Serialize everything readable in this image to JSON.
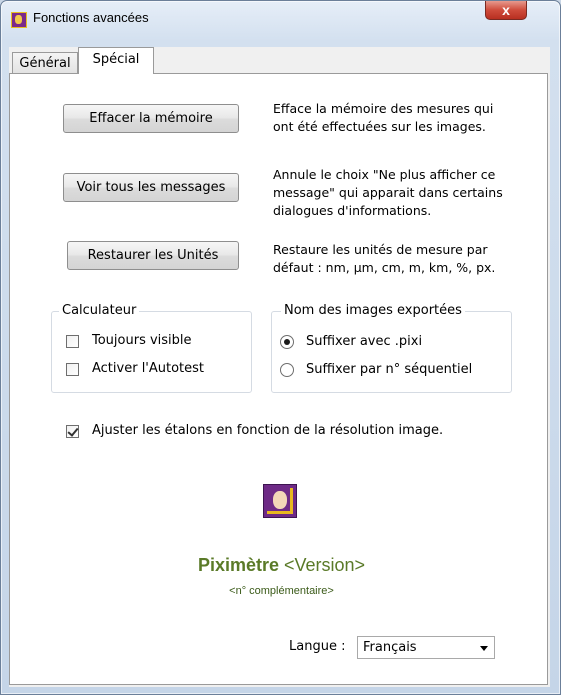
{
  "window": {
    "title": "Fonctions avancées",
    "close_label": "x"
  },
  "tabs": [
    {
      "label": "Général"
    },
    {
      "label": "Spécial"
    }
  ],
  "actions": [
    {
      "button": "Effacer la mémoire",
      "description": [
        "Efface la mémoire des mesures qui",
        "ont été effectuées sur les images."
      ]
    },
    {
      "button": "Voir tous les messages",
      "description": [
        "Annule le choix \"Ne plus afficher ce",
        "message\" qui apparait dans certains",
        "dialogues d'informations."
      ]
    },
    {
      "button": "Restaurer les Unités",
      "description": [
        "Restaure les unités de mesure par",
        "défaut : nm, µm, cm, m, km, %, px."
      ]
    }
  ],
  "calculateur": {
    "title": "Calculateur",
    "options": [
      {
        "label": "Toujours visible",
        "checked": false
      },
      {
        "label": "Activer l'Autotest",
        "checked": false
      }
    ]
  },
  "export_names": {
    "title": "Nom des images exportées",
    "options": [
      {
        "label": "Suffixer avec .pixi",
        "selected": true
      },
      {
        "label": "Suffixer par n° séquentiel",
        "selected": false
      }
    ]
  },
  "adjust": {
    "label": "Ajuster les étalons en fonction de la résolution image.",
    "checked": true
  },
  "product": {
    "name": "Piximètre",
    "version": "<Version>",
    "extra": "<n° complémentaire>"
  },
  "language": {
    "label": "Langue :",
    "value": "Français"
  },
  "colors": {
    "brand_green": "#5a7a28",
    "icon_purple": "#6e2a86",
    "icon_gold": "#e8b820"
  },
  "icons": {
    "app": "piximetre-app-icon",
    "logo": "piximetre-logo-icon"
  }
}
